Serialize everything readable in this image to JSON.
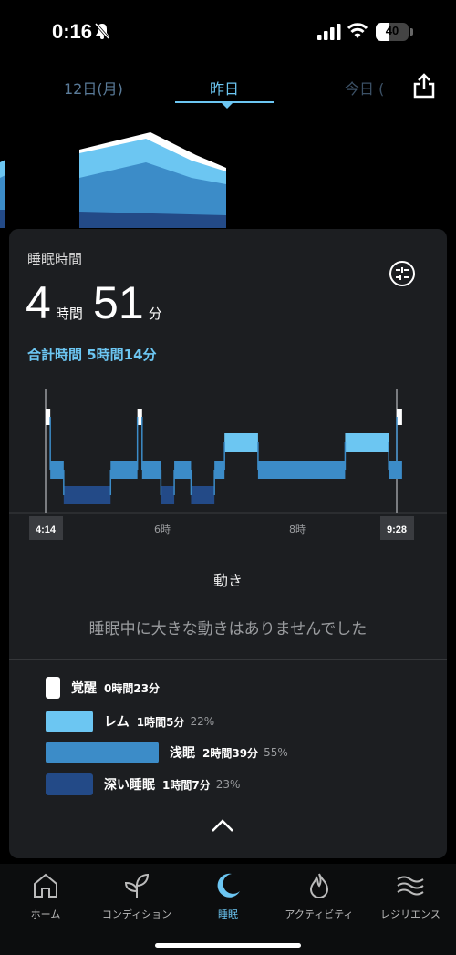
{
  "status": {
    "time": "0:16",
    "battery": "40"
  },
  "tabs": {
    "prev": "12日(月)",
    "current": "昨日",
    "next": "今日 ("
  },
  "card": {
    "label": "睡眠時間",
    "hours": "4",
    "hours_unit": "時間",
    "minutes": "51",
    "minutes_unit": "分",
    "total": "合計時間 5時間14分"
  },
  "chart_data": {
    "type": "area",
    "start_label": "4:14",
    "end_label": "9:28",
    "tick_labels": [
      "6時",
      "8時"
    ],
    "stages": [
      "覚醒",
      "レム",
      "浅眠",
      "深い睡眠"
    ],
    "segments_hours": [
      {
        "stage": "覚醒",
        "start": 4.23,
        "end": 4.3
      },
      {
        "stage": "浅眠",
        "start": 4.3,
        "end": 4.5
      },
      {
        "stage": "深い睡眠",
        "start": 4.5,
        "end": 5.2
      },
      {
        "stage": "浅眠",
        "start": 5.2,
        "end": 5.6
      },
      {
        "stage": "覚醒",
        "start": 5.6,
        "end": 5.67
      },
      {
        "stage": "浅眠",
        "start": 5.67,
        "end": 5.95
      },
      {
        "stage": "深い睡眠",
        "start": 5.95,
        "end": 6.15
      },
      {
        "stage": "浅眠",
        "start": 6.15,
        "end": 6.4
      },
      {
        "stage": "深い睡眠",
        "start": 6.4,
        "end": 6.75
      },
      {
        "stage": "浅眠",
        "start": 6.75,
        "end": 6.9
      },
      {
        "stage": "レム",
        "start": 6.9,
        "end": 7.4
      },
      {
        "stage": "浅眠",
        "start": 7.4,
        "end": 8.7
      },
      {
        "stage": "レム",
        "start": 8.7,
        "end": 9.35
      },
      {
        "stage": "浅眠",
        "start": 9.35,
        "end": 9.55
      },
      {
        "stage": "覚醒",
        "start": 9.55,
        "end": 9.47
      }
    ]
  },
  "motion": {
    "title": "動き",
    "message": "睡眠中に大きな動きはありませんでした"
  },
  "legend": [
    {
      "name": "覚醒",
      "duration": "0時間23分",
      "pct": "",
      "color": "#ffffff",
      "fraction": 0.07
    },
    {
      "name": "レム",
      "duration": "1時間5分",
      "pct": "22%",
      "color": "#6cc6f2",
      "fraction": 0.22
    },
    {
      "name": "浅眠",
      "duration": "2時間39分",
      "pct": "55%",
      "color": "#3c8cc8",
      "fraction": 0.55
    },
    {
      "name": "深い睡眠",
      "duration": "1時間7分",
      "pct": "23%",
      "color": "#234a87",
      "fraction": 0.23
    }
  ],
  "nav": {
    "home": "ホーム",
    "condition": "コンディション",
    "sleep": "睡眠",
    "activity": "アクティビティ",
    "resilience": "レジリエンス"
  }
}
